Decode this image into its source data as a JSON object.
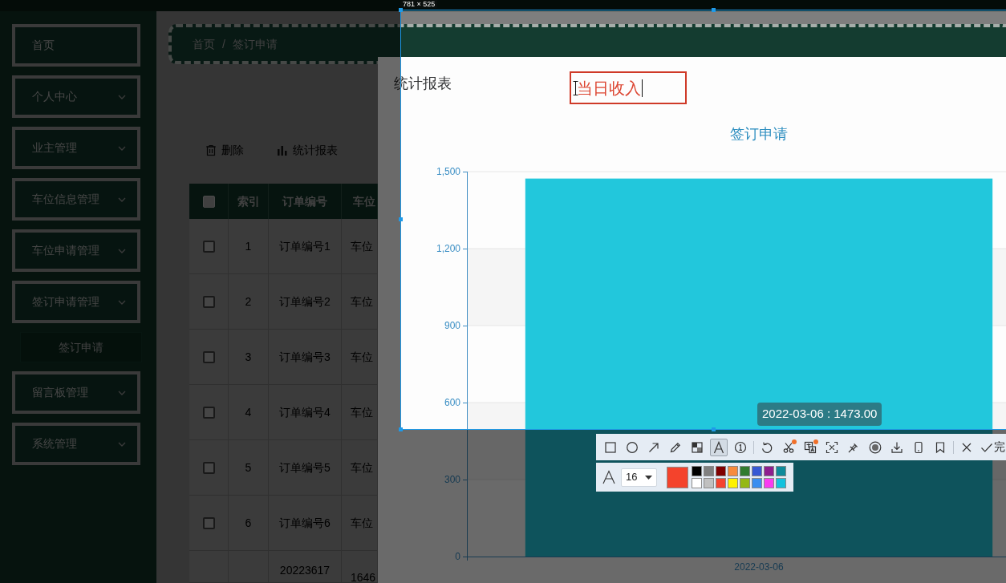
{
  "sidebar": {
    "items": [
      {
        "label": "首页",
        "kind": "link"
      },
      {
        "label": "个人中心",
        "kind": "submenu"
      },
      {
        "label": "业主管理",
        "kind": "submenu"
      },
      {
        "label": "车位信息管理",
        "kind": "submenu"
      },
      {
        "label": "车位申请管理",
        "kind": "submenu"
      },
      {
        "label": "签订申请管理",
        "kind": "submenu",
        "children": [
          {
            "label": "签订申请"
          }
        ]
      },
      {
        "label": "留言板管理",
        "kind": "submenu"
      },
      {
        "label": "系统管理",
        "kind": "submenu"
      }
    ]
  },
  "breadcrumb": {
    "items": [
      "首页",
      "签订申请"
    ],
    "separator": "/"
  },
  "actions": [
    {
      "label": "删除",
      "kind": "delete"
    },
    {
      "label": "统计报表",
      "kind": "report"
    }
  ],
  "table": {
    "columns": [
      {
        "kind": "checkbox",
        "checked": false
      },
      {
        "kind": "index",
        "label": "索引"
      },
      {
        "kind": "order_no",
        "label": "订单编号"
      },
      {
        "kind": "parking_space",
        "label": "车位"
      }
    ],
    "rows": [
      {
        "checked": false,
        "index": "1",
        "order_no": "订单编号1",
        "parking_space": "车位"
      },
      {
        "checked": false,
        "index": "2",
        "order_no": "订单编号2",
        "parking_space": "车位"
      },
      {
        "checked": false,
        "index": "3",
        "order_no": "订单编号3",
        "parking_space": "车位"
      },
      {
        "checked": false,
        "index": "4",
        "order_no": "订单编号4",
        "parking_space": "车位"
      },
      {
        "checked": false,
        "index": "5",
        "order_no": "订单编号5",
        "parking_space": "车位"
      },
      {
        "checked": false,
        "index": "6",
        "order_no": "订单编号6",
        "parking_space": "车位"
      },
      {
        "order_no": "20223617",
        "parking_space": "1646"
      }
    ]
  },
  "dialog": {
    "title": "统计报表",
    "chart_data": {
      "type": "bar",
      "title": "签订申请",
      "categories": [
        "2022-03-06"
      ],
      "series": [
        {
          "color": "#22c7dc",
          "values": [
            1473
          ]
        }
      ],
      "ylim": [
        0,
        1500
      ],
      "yticks": [
        0,
        300,
        600,
        900,
        {
          "value": 1200,
          "label": "1,200"
        },
        {
          "value": 1500,
          "label": "1,500"
        }
      ],
      "grid": true
    },
    "tooltip": "2022-03-06 : 1473.00"
  },
  "screenshot_tool": {
    "size_label": "781 × 525",
    "text_annotation": "当日收入",
    "tool_groups": [
      [
        {
          "kind": "rectangle",
          "selected": false,
          "badge": false
        },
        {
          "kind": "ellipse",
          "selected": false,
          "badge": false
        },
        {
          "kind": "arrow",
          "selected": false,
          "badge": false
        },
        {
          "kind": "pencil",
          "selected": false,
          "badge": false
        },
        {
          "kind": "mosaic",
          "selected": false,
          "badge": false
        },
        {
          "kind": "text",
          "selected": true,
          "badge": false
        },
        {
          "kind": "number",
          "selected": false,
          "badge": false
        }
      ],
      [
        {
          "kind": "undo",
          "selected": false,
          "badge": false
        },
        {
          "kind": "cut",
          "selected": false,
          "badge": true
        },
        {
          "kind": "translate",
          "selected": false,
          "badge": true
        },
        {
          "kind": "ocr",
          "selected": false,
          "badge": false
        },
        {
          "kind": "pin",
          "selected": false,
          "badge": false
        },
        {
          "kind": "record",
          "selected": false,
          "badge": false
        },
        {
          "kind": "download",
          "selected": false,
          "badge": false
        },
        {
          "kind": "phone",
          "selected": false,
          "badge": false
        },
        {
          "kind": "bookmark",
          "selected": false,
          "badge": false
        }
      ],
      [
        {
          "kind": "close",
          "selected": false,
          "badge": false
        },
        {
          "kind": "done",
          "label": "完",
          "selected": false,
          "badge": false
        }
      ]
    ],
    "text_options": {
      "font_size": "16",
      "current_swatch": {
        "color": "#f4432c"
      },
      "palette": [
        {
          "color": "#000000"
        },
        {
          "color": "#808080"
        },
        {
          "color": "#800000"
        },
        {
          "color": "#f78b3c"
        },
        {
          "color": "#317b2f"
        },
        {
          "color": "#3759d4"
        },
        {
          "color": "#8e1e8e"
        },
        {
          "color": "#0e8a9a"
        },
        {
          "color": "#ffffff"
        },
        {
          "color": "#c0c0c0"
        },
        {
          "color": "#f5432f"
        },
        {
          "color": "#fff200"
        },
        {
          "color": "#94b814"
        },
        {
          "color": "#3a8ef0"
        },
        {
          "color": "#f83cf0"
        },
        {
          "color": "#12c2de"
        }
      ]
    }
  }
}
